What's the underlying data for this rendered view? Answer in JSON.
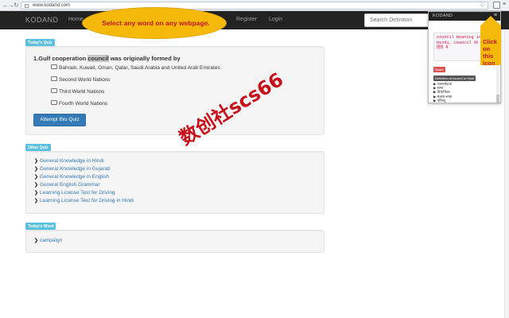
{
  "browser": {
    "url": "www.kodand.com",
    "back_icon": "back-arrow-icon",
    "forward_icon": "forward-arrow-icon",
    "reload_icon": "reload-icon"
  },
  "navbar": {
    "brand": "KODAND",
    "links": [
      "Home",
      "Register",
      "Login"
    ],
    "search_placeholder": "Search Definition"
  },
  "tooltip_bubble": {
    "text": "Select any word on any webpage."
  },
  "callout": {
    "text": "Click on this icon"
  },
  "popup": {
    "title": "KODAND",
    "code_text": "council meaning in Hindi, council का अर्थ हिंदी में",
    "badge": "Share",
    "label": "Definition of council in Hindi",
    "items": [
      "▶ परामर्शदाता",
      "▶ सभा",
      "▶ विधायिका",
      "▶ मंत्रणा-सभा",
      "▶ परिषद्"
    ]
  },
  "quiz": {
    "section_label": "Today's Quiz",
    "question_number": "1.",
    "question_before": "Gulf cooperation ",
    "question_highlight": "council",
    "question_after": " was originally formed by",
    "options": [
      "Bahrain, Kuwait, Oman, Qatar, Saudi Arabia and United Arab Emirates",
      "Second World Nations",
      "Third World Nations",
      "Fourth World Nations"
    ],
    "attempt_button": "Attempt this Quiz"
  },
  "other_quiz": {
    "section_label": "Other Quiz",
    "links": [
      "General Knowledge in Hindi",
      "General Knowledge in Gujarati",
      "General Knowledge in English",
      "General English Grammar",
      "Learning License Test for Driving",
      "Learning License Test for Driving in Hindi"
    ]
  },
  "todays_word": {
    "section_label": "Today's Word",
    "word": "campaign"
  },
  "watermark": "数创社scs66",
  "colors": {
    "navbar": "#222222",
    "accent": "#337ab7",
    "label": "#5bc0de",
    "highlight": "#f5b90a"
  }
}
